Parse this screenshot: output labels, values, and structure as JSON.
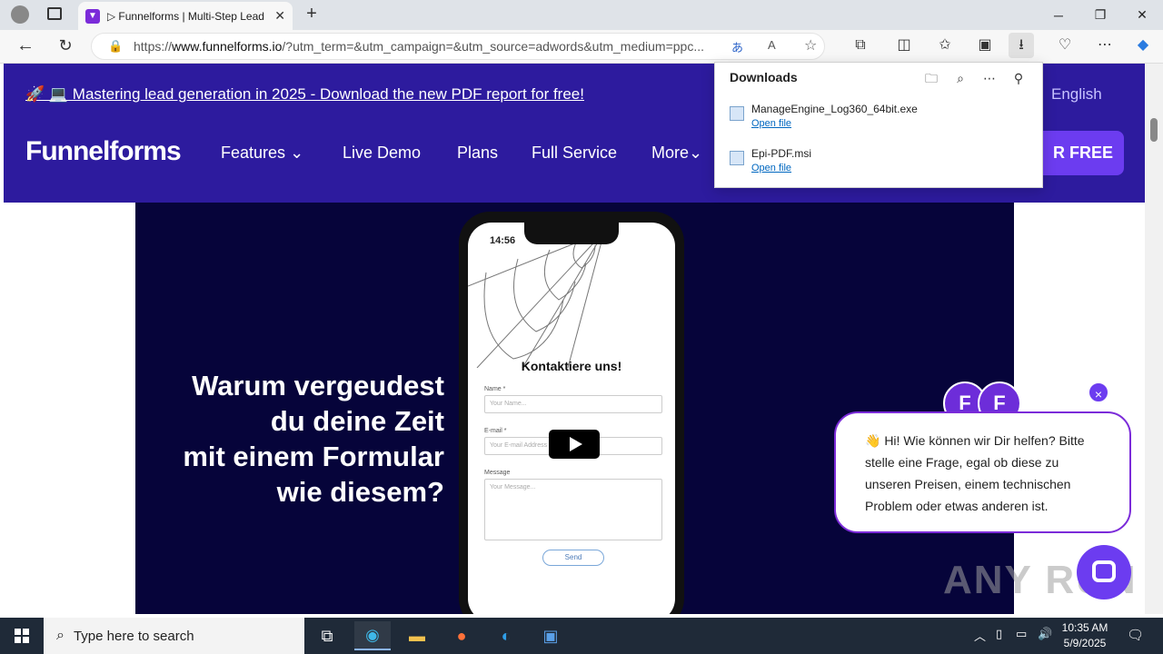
{
  "browser": {
    "tab_title": "▷ Funnelforms | Multi-Step Lead",
    "url_prefix": "https://",
    "url_domain": "www.funnelforms.io",
    "url_rest": "/?utm_term=&utm_campaign=&utm_source=adwords&utm_medium=ppc..."
  },
  "site": {
    "promo": "🚀 💻 Mastering lead generation in 2025 - Download the new PDF report for free!",
    "language": "English",
    "logo": "Funnelforms",
    "menu": [
      "Features",
      "Live Demo",
      "Plans",
      "Full Service",
      "More"
    ],
    "cta_partial": "R FREE"
  },
  "video": {
    "headline_lines": [
      "Warum vergeudest",
      "du deine Zeit",
      "mit einem Formular",
      "wie diesem?"
    ],
    "phone_time": "14:56",
    "form_title": "Kontaktiere uns!",
    "name_label": "Name *",
    "name_placeholder": "Your Name...",
    "email_label": "E-mail *",
    "email_placeholder": "Your E-mail Address",
    "message_label": "Message",
    "message_placeholder": "Your Message...",
    "send_label": "Send"
  },
  "chat": {
    "message": "👋 Hi! Wie können wir Dir helfen? Bitte stelle eine Frage, egal ob diese zu unseren Preisen, einem technischen Problem oder etwas anderen ist.",
    "close": "×",
    "avatar_letter": "F"
  },
  "downloads": {
    "title": "Downloads",
    "items": [
      {
        "name": "ManageEngine_Log360_64bit.exe",
        "action": "Open file"
      },
      {
        "name": "Epi-PDF.msi",
        "action": "Open file"
      }
    ]
  },
  "taskbar": {
    "search_placeholder": "Type here to search",
    "time": "10:35 AM",
    "date": "5/9/2025"
  },
  "watermark": "ANY RUN",
  "colors": {
    "brand": "#2d1b9e",
    "accent": "#6c3cf0",
    "chat_border": "#7b2bd9"
  }
}
